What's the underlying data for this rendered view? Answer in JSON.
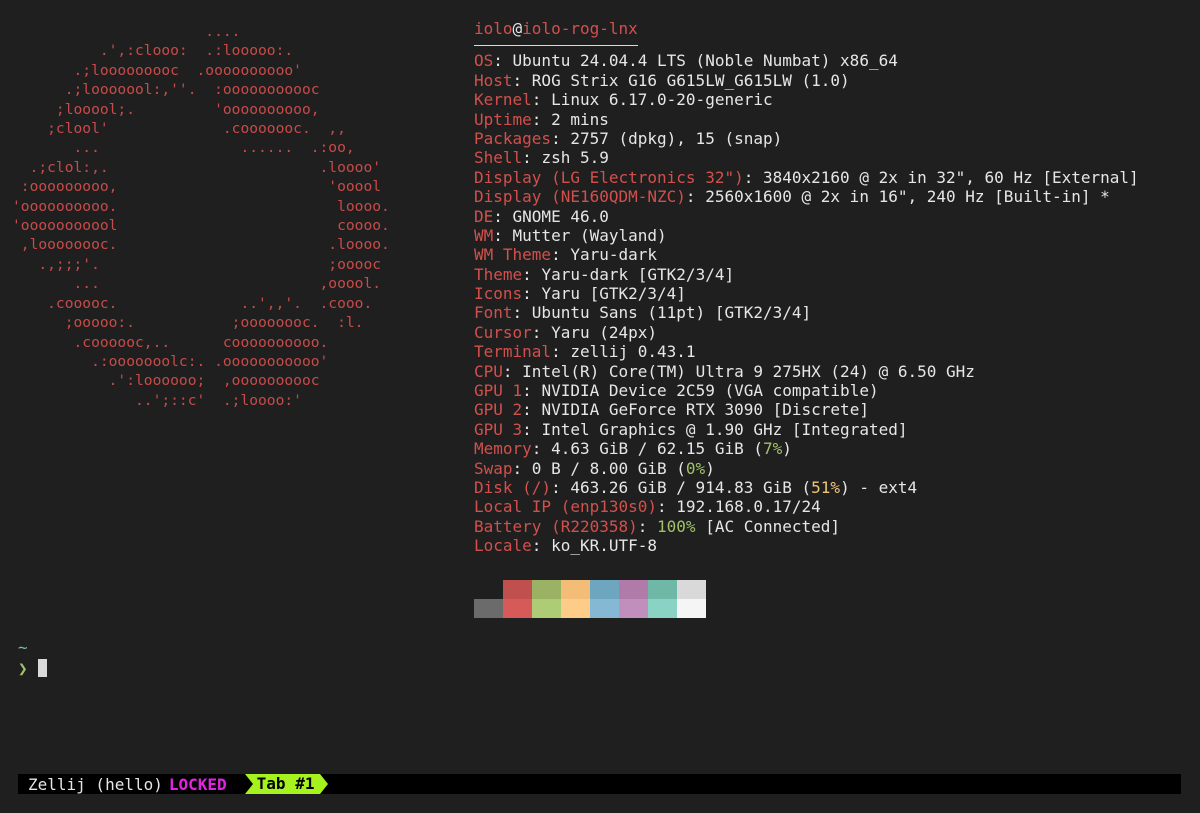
{
  "logo": {
    "art": "                      ....\n          .',:clooo:  .:looooo:.\n       .;looooooooc  .oooooooooo'\n      .;looooool:,''.  :ooooooooooc\n     ;looool;.         'oooooooooo,\n    ;clool'             .cooooooc.  ,,\n       ...                ......  .:oo,\n  .;clol:,.                        .loooo'\n :ooooooooo,                        'ooool\n'oooooooooo.                         loooo.\n'ooooooooool                         coooo.\n ,loooooooc.                        .loooo.\n   .,;;;'.                          ;ooooc\n       ...                         ,ooool.\n    .cooooc.              ..',,'.  .cooo.\n      ;ooooo:.           ;oooooooc.  :l.\n       .coooooc,..      coooooooooo.\n         .:ooooooolc:. .ooooooooooo'\n           .':loooooo;  ,oooooooooc\n              ..';::c'  .;loooo:'"
  },
  "info": {
    "user": "iolo",
    "at": "@",
    "host": "iolo-rog-lnx",
    "rows": [
      {
        "key": "OS",
        "value": "Ubuntu 24.04.4 LTS (Noble Numbat) x86_64"
      },
      {
        "key": "Host",
        "value": "ROG Strix G16 G615LW_G615LW (1.0)"
      },
      {
        "key": "Kernel",
        "value": "Linux 6.17.0-20-generic"
      },
      {
        "key": "Uptime",
        "value": "2 mins"
      },
      {
        "key": "Packages",
        "value": "2757 (dpkg), 15 (snap)"
      },
      {
        "key": "Shell",
        "value": "zsh 5.9"
      },
      {
        "key": "Display (LG Electronics 32\")",
        "value": "3840x2160 @ 2x in 32\", 60 Hz [External]"
      },
      {
        "key": "Display (NE160QDM-NZC)",
        "value": "2560x1600 @ 2x in 16\", 240 Hz [Built-in] *"
      },
      {
        "key": "DE",
        "value": "GNOME 46.0"
      },
      {
        "key": "WM",
        "value": "Mutter (Wayland)"
      },
      {
        "key": "WM Theme",
        "value": "Yaru-dark"
      },
      {
        "key": "Theme",
        "value": "Yaru-dark [GTK2/3/4]"
      },
      {
        "key": "Icons",
        "value": "Yaru [GTK2/3/4]"
      },
      {
        "key": "Font",
        "value": "Ubuntu Sans (11pt) [GTK2/3/4]"
      },
      {
        "key": "Cursor",
        "value": "Yaru (24px)"
      },
      {
        "key": "Terminal",
        "value": "zellij 0.43.1"
      },
      {
        "key": "CPU",
        "value": "Intel(R) Core(TM) Ultra 9 275HX (24) @ 6.50 GHz"
      },
      {
        "key": "GPU 1",
        "value": "NVIDIA Device 2C59 (VGA compatible)"
      },
      {
        "key": "GPU 2",
        "value": "NVIDIA GeForce RTX 3090 [Discrete]"
      },
      {
        "key": "GPU 3",
        "value": "Intel Graphics @ 1.90 GHz [Integrated]"
      },
      {
        "key": "Memory",
        "value_before": "4.63 GiB / 62.15 GiB (",
        "pct": "7%",
        "pct_color": "#a3c16a",
        "value_after": ")"
      },
      {
        "key": "Swap",
        "value_before": "0 B / 8.00 GiB (",
        "pct": "0%",
        "pct_color": "#a3c16a",
        "value_after": ")"
      },
      {
        "key": "Disk (/)",
        "value_before": "463.26 GiB / 914.83 GiB (",
        "pct": "51%",
        "pct_color": "#f0c674",
        "value_after": ") - ext4"
      },
      {
        "key": "Local IP (enp130s0)",
        "value": "192.168.0.17/24"
      },
      {
        "key": "Battery (R220358)",
        "value_before": "",
        "pct": "100%",
        "pct_color": "#a3c16a",
        "value_after": " [AC Connected]"
      },
      {
        "key": "Locale",
        "value": "ko_KR.UTF-8"
      }
    ]
  },
  "palette": {
    "normal": [
      "#1f1f1f",
      "#c0504d",
      "#9bb164",
      "#f3bd78",
      "#6fa6bf",
      "#b07ba9",
      "#6fb8a8",
      "#d9d9d9"
    ],
    "bright": [
      "#6b6b6b",
      "#d65a58",
      "#aecb76",
      "#fdcc88",
      "#85b8d2",
      "#c18fbb",
      "#8ad3c4",
      "#f5f5f5"
    ]
  },
  "prompt": {
    "cwd": "~",
    "chevron": "❯"
  },
  "statusbar": {
    "session": "Zellij (hello)",
    "mode": "LOCKED",
    "tab": "Tab #1"
  }
}
